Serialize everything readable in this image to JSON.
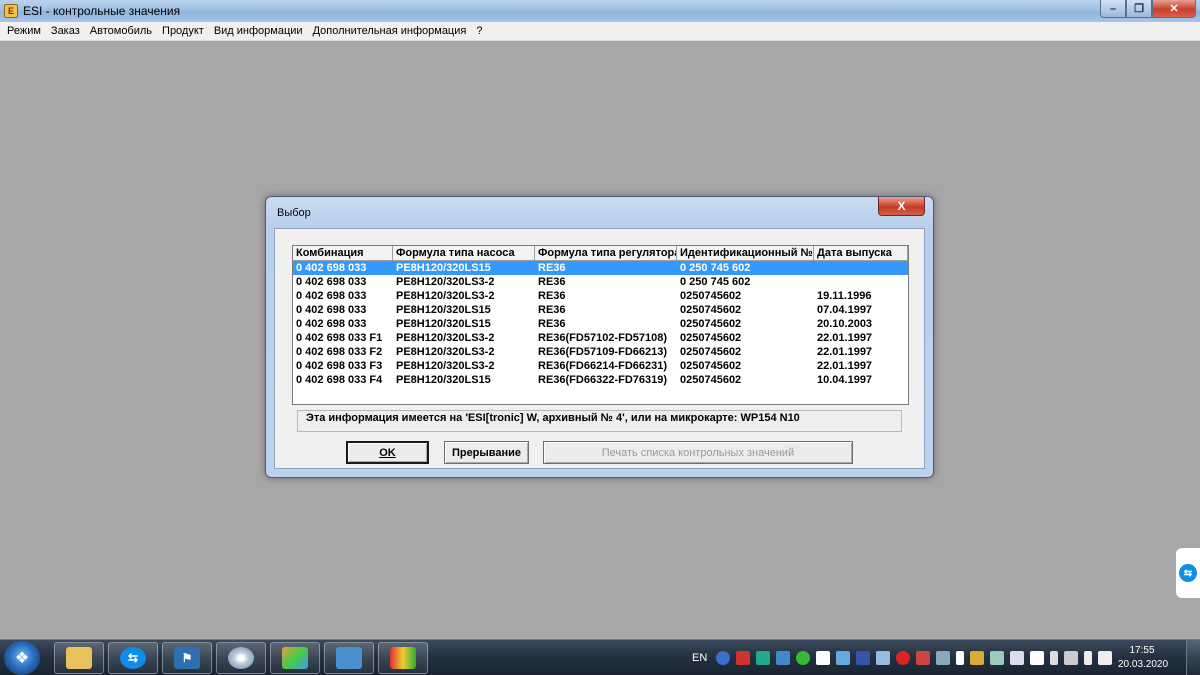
{
  "window": {
    "title": "ESI - контрольные значения"
  },
  "menu": [
    "Режим",
    "Заказ",
    "Автомобиль",
    "Продукт",
    "Вид информации",
    "Дополнительная информация",
    "?"
  ],
  "dialog": {
    "title": "Выбор",
    "close_glyph": "X",
    "columns": [
      "Комбинация",
      "Формула типа насоса",
      "Формула типа регулятора",
      "Идентификационный № к",
      "Дата выпуска"
    ],
    "rows": [
      [
        "0 402 698 033",
        "PE8H120/320LS15",
        "RE36",
        "0 250 745 602",
        ""
      ],
      [
        "0 402 698 033",
        "PE8H120/320LS3-2",
        "RE36",
        "0 250 745 602",
        ""
      ],
      [
        "0 402 698 033",
        "PE8H120/320LS3-2",
        "RE36",
        "0250745602",
        "19.11.1996"
      ],
      [
        "0 402 698 033",
        "PE8H120/320LS15",
        "RE36",
        "0250745602",
        "07.04.1997"
      ],
      [
        "0 402 698 033",
        "PE8H120/320LS15",
        "RE36",
        "0250745602",
        "20.10.2003"
      ],
      [
        "0 402 698 033 F1",
        "PE8H120/320LS3-2",
        "RE36(FD57102-FD57108)",
        "0250745602",
        "22.01.1997"
      ],
      [
        "0 402 698 033 F2",
        "PE8H120/320LS3-2",
        "RE36(FD57109-FD66213)",
        "0250745602",
        "22.01.1997"
      ],
      [
        "0 402 698 033 F3",
        "PE8H120/320LS3-2",
        "RE36(FD66214-FD66231)",
        "0250745602",
        "22.01.1997"
      ],
      [
        "0 402 698 033 F4",
        "PE8H120/320LS15",
        "RE36(FD66322-FD76319)",
        "0250745602",
        "10.04.1997"
      ]
    ],
    "selected_row": 0,
    "info": "Эта информация имеется на 'ESI[tronic] W, архивный № 4', или на микрокарте: WP154 N10",
    "buttons": {
      "ok": "OK",
      "cancel": "Прерывание",
      "print": "Печать списка контрольных значений"
    }
  },
  "taskbar": {
    "language": "EN",
    "time": "17:55",
    "date": "20.03.2020",
    "pinned_icons": [
      "explorer-icon",
      "teamviewer-icon",
      "car-diagnostics-icon",
      "disc-icon",
      "paint-icon",
      "monitor-icon",
      "esi-icon"
    ]
  },
  "colors": {
    "selection": "#3399ff",
    "workspace": "#a7a7a7",
    "dialog_frame": "#bcd3ee",
    "close_red": "#c73d26"
  }
}
